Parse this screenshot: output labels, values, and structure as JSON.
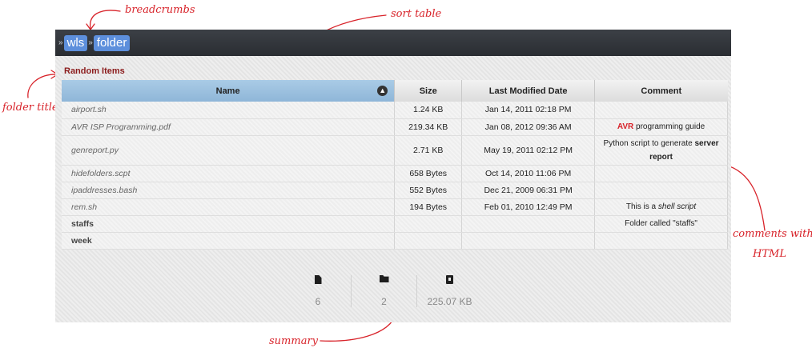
{
  "annotations": {
    "breadcrumbs": "breadcrumbs",
    "sort_table": "sort table",
    "folder_title": "folder title",
    "comments_line1": "comments with",
    "comments_line2": "HTML",
    "summary": "summary",
    "color": "#d8232a"
  },
  "breadcrumbs": [
    "wls",
    "folder"
  ],
  "breadcrumb_separator": "»",
  "folder_title": "Random Items",
  "table": {
    "columns": [
      "Name",
      "Size",
      "Last Modified Date",
      "Comment"
    ],
    "sort_icon": "sort-up-icon",
    "rows": [
      {
        "name": "airport.sh",
        "size": "1.24 KB",
        "date": "Jan 14, 2011 02:18 PM",
        "comment": ""
      },
      {
        "name": "AVR ISP Programming.pdf",
        "size": "219.34 KB",
        "date": "Jan 08, 2012 09:36 AM",
        "comment_parts": [
          "AVR",
          " programming guide"
        ]
      },
      {
        "name": "genreport.py",
        "size": "2.71 KB",
        "date": "May 19, 2011 02:12 PM",
        "comment_parts": [
          "Python script to generate ",
          "server report"
        ]
      },
      {
        "name": "hidefolders.scpt",
        "size": "658 Bytes",
        "date": "Oct 14, 2010 11:06 PM",
        "comment": ""
      },
      {
        "name": "ipaddresses.bash",
        "size": "552 Bytes",
        "date": "Dec 21, 2009 06:31 PM",
        "comment": ""
      },
      {
        "name": "rem.sh",
        "size": "194 Bytes",
        "date": "Feb 01, 2010 12:49 PM",
        "comment_parts": [
          "This is a ",
          "shell script"
        ]
      },
      {
        "name": "staffs",
        "size": "",
        "date": "",
        "comment": "Folder called \"staffs\""
      },
      {
        "name": "week",
        "size": "",
        "date": "",
        "comment": ""
      }
    ]
  },
  "summary": {
    "file_count": "6",
    "folder_count": "2",
    "total_size": "225.07 KB"
  }
}
